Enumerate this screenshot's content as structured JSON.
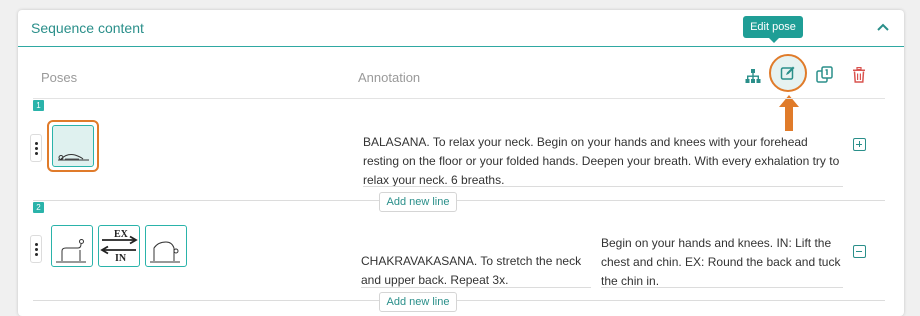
{
  "section": {
    "title": "Sequence content",
    "collapse_icon": "chevron-up-icon"
  },
  "tooltip": {
    "text": "Edit pose"
  },
  "columns": {
    "poses": "Poses",
    "annotation": "Annotation"
  },
  "toolbar": {
    "icons": [
      "hierarchy-icon",
      "edit-icon",
      "duplicate-icon",
      "trash-icon"
    ]
  },
  "rows": [
    {
      "number": "1",
      "pose_icons": [
        "balasana-pose-icon"
      ],
      "annotation": "BALASANA. To relax your neck. Begin on your hands and knees with your forehead resting on the floor or your folded hands. Deepen your breath. With every exhalation try to relax your neck. 6 breaths.",
      "add_line_label": "Add new line",
      "toggle_icon": "plus-square-icon"
    },
    {
      "number": "2",
      "pose_icons": [
        "cat-pose-icon",
        "ex-in-breath-icon",
        "cow-pose-icon"
      ],
      "breath_ex": "EX",
      "breath_in": "IN",
      "annotation": "CHAKRAVAKASANA. To stretch the neck and upper back. Repeat 3x.",
      "annotation_2": "Begin on your hands and knees. IN: Lift the chest and chin. EX: Round the back and tuck the chin in.",
      "add_line_label": "Add new line",
      "toggle_icon": "minus-square-icon"
    }
  ],
  "colors": {
    "accent": "#2a8f8a",
    "highlight": "#e07b2a",
    "danger": "#d9534f"
  }
}
